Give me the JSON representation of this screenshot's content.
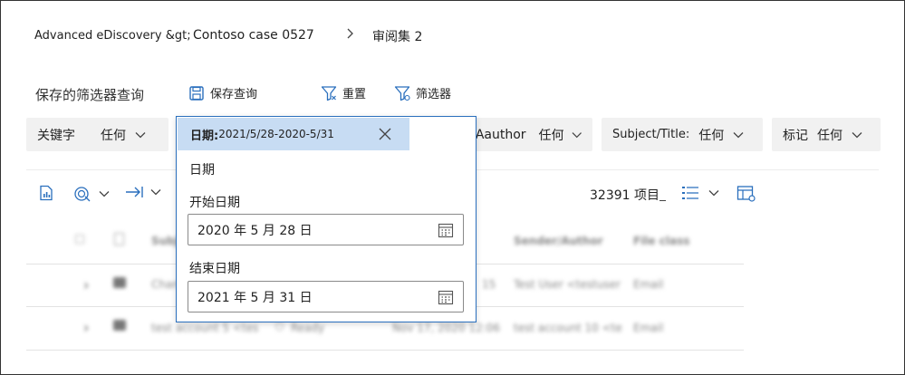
{
  "breadcrumb": {
    "part1": "Advanced eDiscovery &gt;",
    "part2": "Contoso case 0527",
    "part3": "审阅集 2"
  },
  "toolbar": {
    "saved_queries_title": "保存的筛选器查询",
    "save_query_label": "保存查询",
    "reset_label": "重置",
    "filters_label": "筛选器"
  },
  "filters": {
    "keyword": {
      "label": "关键字",
      "value": "任何"
    },
    "author": {
      "label": "Aauthor",
      "value": "任何"
    },
    "subject": {
      "label": "Subject/Title:",
      "value": "任何"
    },
    "tags": {
      "label": "标记",
      "value": "任何"
    }
  },
  "date_dropdown": {
    "header_label": "日期:",
    "header_value": "2021/5/28-2020-5/31",
    "section_label": "日期",
    "start_label": "开始日期",
    "start_value": "2020 年 5 月 28 日",
    "end_label": "结束日期",
    "end_value": "2021 年 5 月 31 日"
  },
  "results": {
    "count_text": "32391 项目"
  },
  "table": {
    "columns": [
      "Subject",
      "Sender/Author",
      "File class"
    ],
    "rows": [
      {
        "subject": "Chan",
        "date": "15",
        "sender": "Test User <testuser",
        "file_class": "Email"
      },
      {
        "subject": "test account 5 <tes",
        "status": "Ready",
        "date": "Nov 17, 2020 12:06",
        "sender": "test account 10 <te",
        "file_class": "Email"
      }
    ]
  },
  "colors": {
    "accent": "#2a6fbd",
    "header_highlight": "#c7dcf3",
    "chip_bg": "#f1f1f1"
  }
}
